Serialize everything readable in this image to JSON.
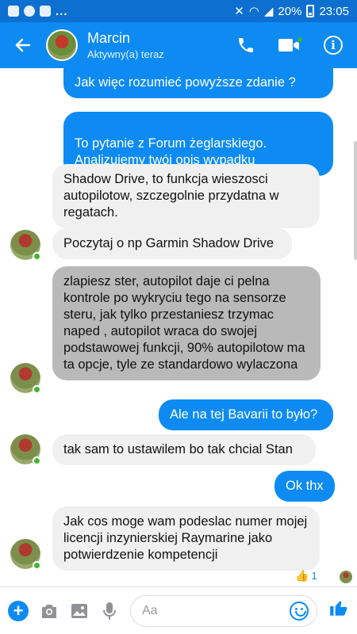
{
  "status_bar": {
    "battery": "20%",
    "time": "23:05",
    "dots": "..."
  },
  "header": {
    "back_icon": "arrow-left-icon",
    "name": "Marcin",
    "status": "Aktywny(a) teraz",
    "call_icon": "phone-icon",
    "video_icon": "video-camera-icon",
    "info_icon": "info-icon"
  },
  "messages": [
    {
      "from": "me",
      "text": "Jak więc rozumieć powyższe zdanie ?"
    },
    {
      "from": "me",
      "text": "To pytanie z Forum żeglarskiego.\nAnalizujemy twój opis wypadku"
    },
    {
      "from": "them",
      "text": "Shadow Drive, to funkcja wieszosci autopilotow, szczegolnie przydatna w regatach."
    },
    {
      "from": "them",
      "text": "Poczytaj o np Garmin Shadow Drive"
    },
    {
      "from": "them",
      "text": "zlapiesz ster, autopilot daje ci pelna kontrole po wykryciu tego na sensorze steru, jak tylko przestaniesz trzymac naped , autopilot wraca do swojej podstawowej funkcji, 90% autopilotow ma ta opcje, tyle ze standardowo wylaczona"
    },
    {
      "from": "me",
      "text": "Ale na tej Bavarii to było?"
    },
    {
      "from": "them",
      "text": "tak sam to ustawilem bo tak chcial Stan"
    },
    {
      "from": "me",
      "text": "Ok thx"
    },
    {
      "from": "them",
      "text": "Jak cos moge wam podeslac numer mojej licencji inzynierskiej Raymarine jako potwierdzenie kompetencji"
    }
  ],
  "reaction": {
    "icon": "thumbs-up-icon",
    "count": "1"
  },
  "composer": {
    "placeholder": "Aa",
    "plus_icon": "plus-icon",
    "camera_icon": "camera-icon",
    "gallery_icon": "image-icon",
    "mic_icon": "microphone-icon",
    "emoji_icon": "smiley-icon",
    "like_icon": "thumbs-up-icon"
  },
  "colors": {
    "brand": "#0d8bf2",
    "statusbar": "#0d6fd0",
    "incoming": "#f0f0f0",
    "selected": "#b9b9b9",
    "online": "#42b72a"
  }
}
